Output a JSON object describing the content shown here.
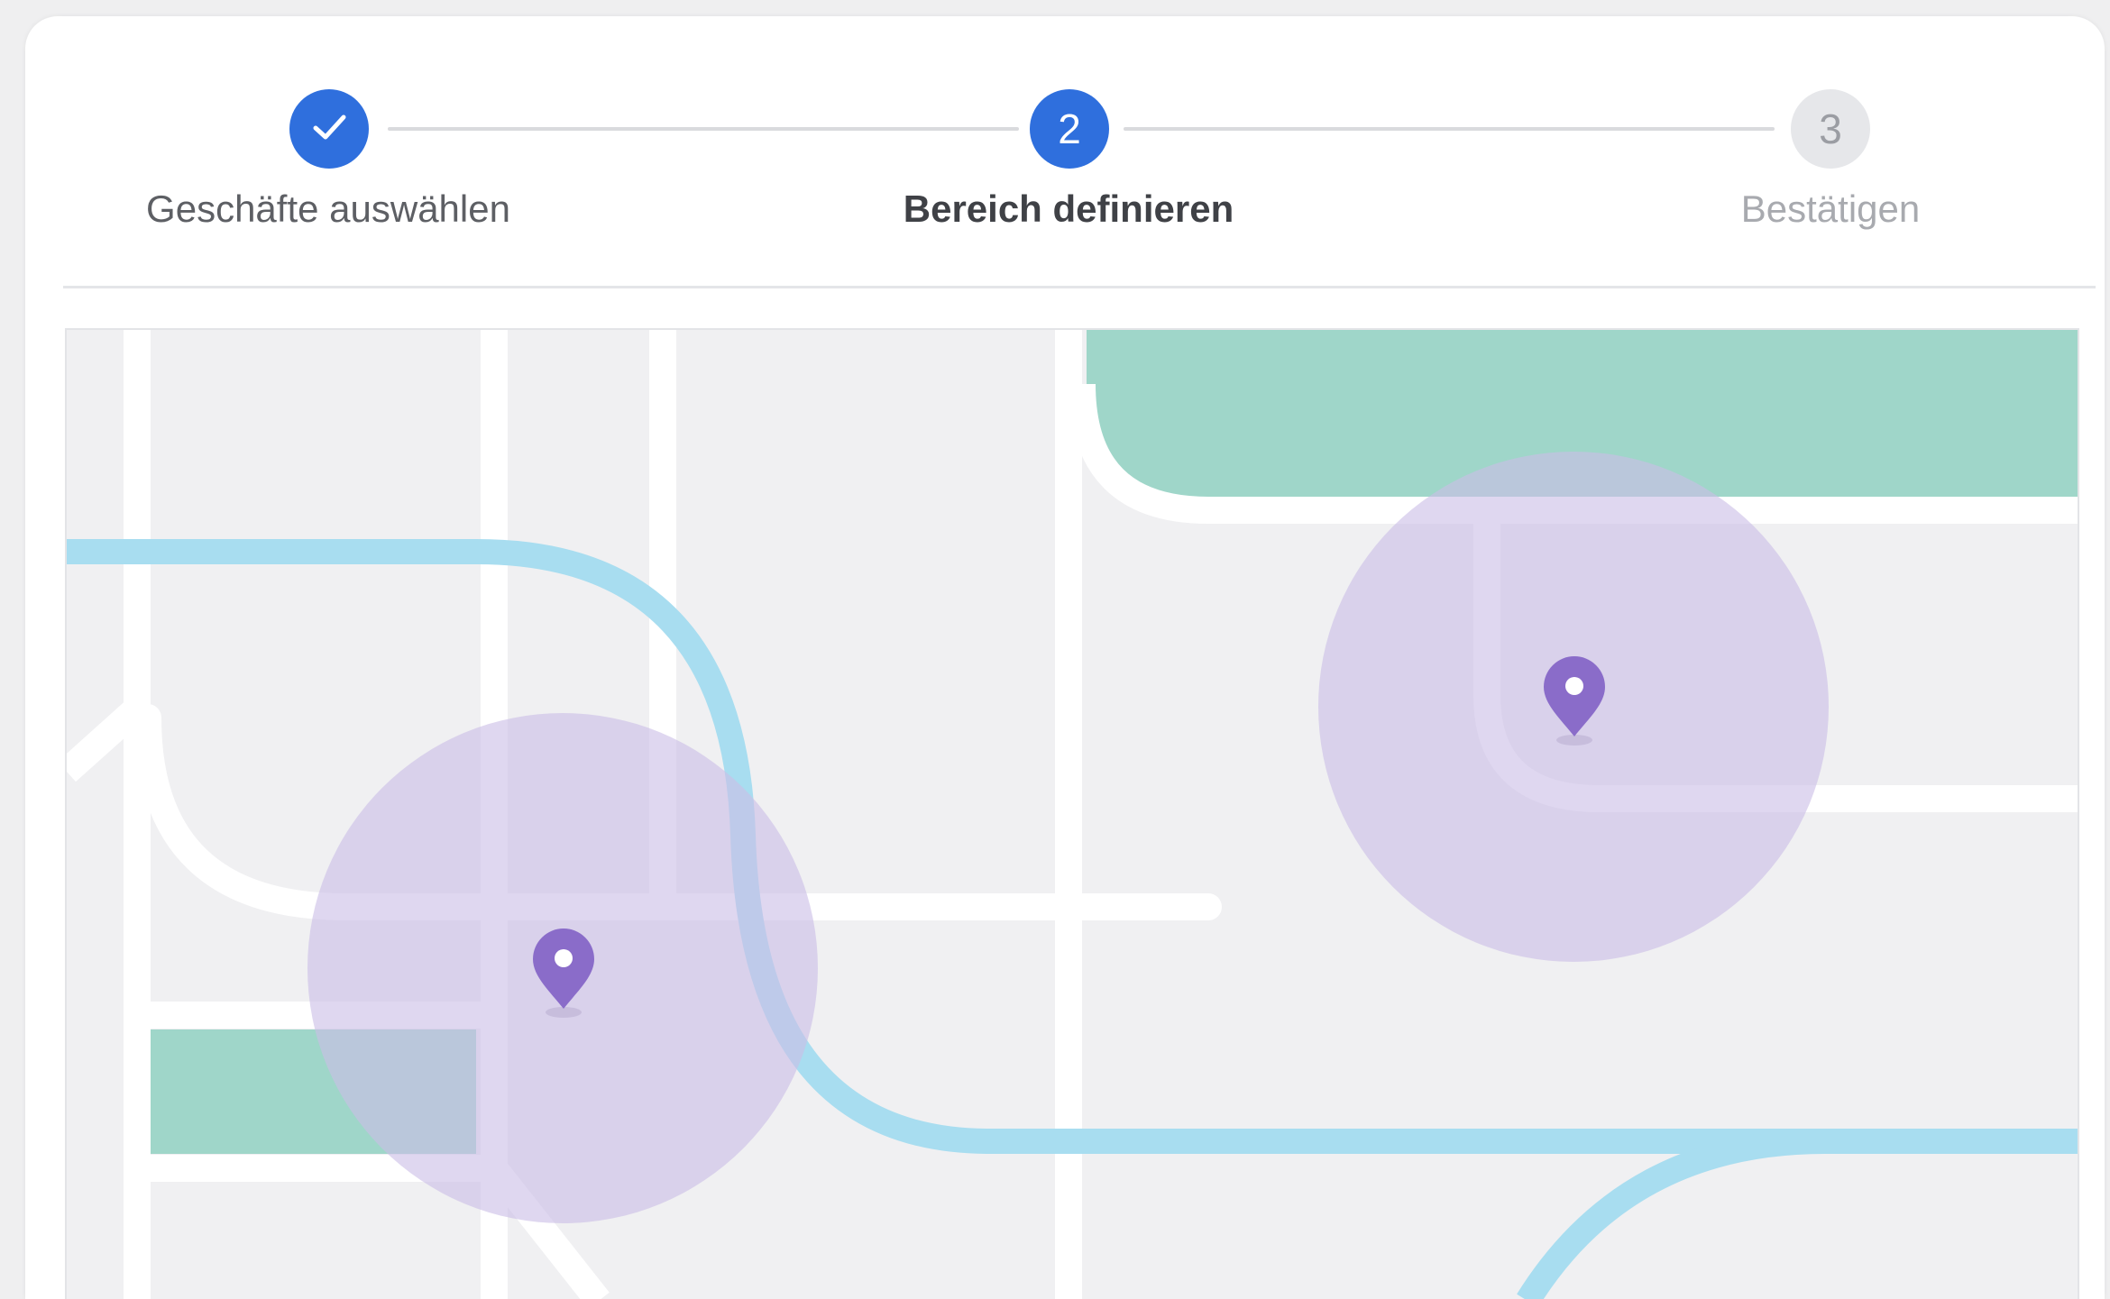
{
  "stepper": {
    "steps": [
      {
        "label": "Geschäfte auswählen",
        "state": "done",
        "icon": "check-icon"
      },
      {
        "label": "Bereich definieren",
        "state": "active",
        "number": "2"
      },
      {
        "label": "Bestätigen",
        "state": "pending",
        "number": "3"
      }
    ]
  },
  "colors": {
    "accent": "#2f6fdd",
    "map_background": "#f0f0f2",
    "road": "#ffffff",
    "river": "#a8ddf0",
    "park": "#9fd6c9",
    "radius_fill": "#cbbfe6",
    "pin": "#8a6cc9"
  },
  "map": {
    "pins": [
      {
        "name": "store-pin-1",
        "icon": "map-pin-icon"
      },
      {
        "name": "store-pin-2",
        "icon": "map-pin-icon"
      }
    ]
  }
}
